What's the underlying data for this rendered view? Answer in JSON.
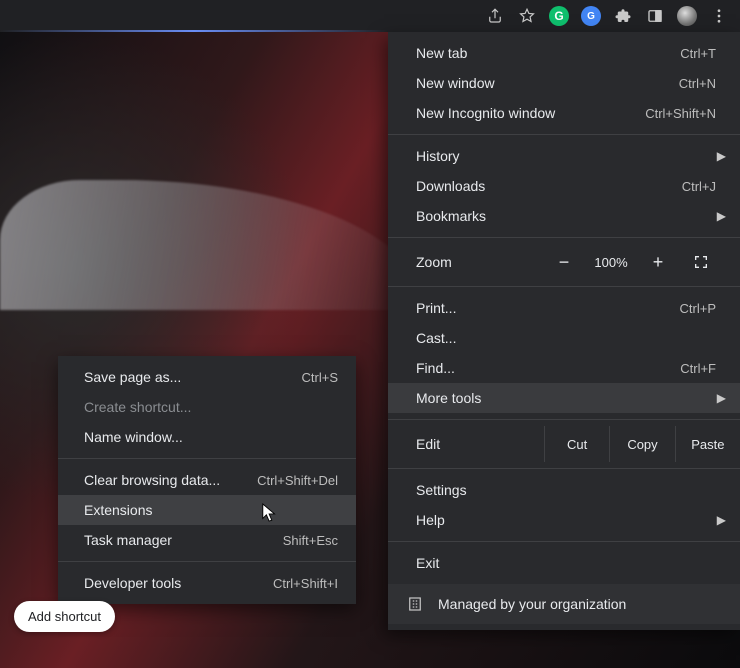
{
  "toolbar": {
    "share_icon": "share-icon",
    "star_icon": "star-icon",
    "grammarly_label": "G",
    "gtranslate_label": "G",
    "puzzle_icon": "extensions-puzzle-icon",
    "panel_icon": "side-panel-icon",
    "avatar_icon": "avatar-icon",
    "menu_icon": "kebab-menu-icon"
  },
  "menu": {
    "new_tab": "New tab",
    "new_tab_sc": "Ctrl+T",
    "new_window": "New window",
    "new_window_sc": "Ctrl+N",
    "new_incognito": "New Incognito window",
    "new_incognito_sc": "Ctrl+Shift+N",
    "history": "History",
    "downloads": "Downloads",
    "downloads_sc": "Ctrl+J",
    "bookmarks": "Bookmarks",
    "zoom_label": "Zoom",
    "zoom_value": "100%",
    "print": "Print...",
    "print_sc": "Ctrl+P",
    "cast": "Cast...",
    "find": "Find...",
    "find_sc": "Ctrl+F",
    "more_tools": "More tools",
    "edit_label": "Edit",
    "cut": "Cut",
    "copy": "Copy",
    "paste": "Paste",
    "settings": "Settings",
    "help": "Help",
    "exit": "Exit",
    "managed": "Managed by your organization"
  },
  "submenu": {
    "save_page": "Save page as...",
    "save_page_sc": "Ctrl+S",
    "create_shortcut": "Create shortcut...",
    "name_window": "Name window...",
    "clear_data": "Clear browsing data...",
    "clear_data_sc": "Ctrl+Shift+Del",
    "extensions": "Extensions",
    "task_manager": "Task manager",
    "task_manager_sc": "Shift+Esc",
    "dev_tools": "Developer tools",
    "dev_tools_sc": "Ctrl+Shift+I"
  },
  "shortcut_pill": "Add shortcut"
}
